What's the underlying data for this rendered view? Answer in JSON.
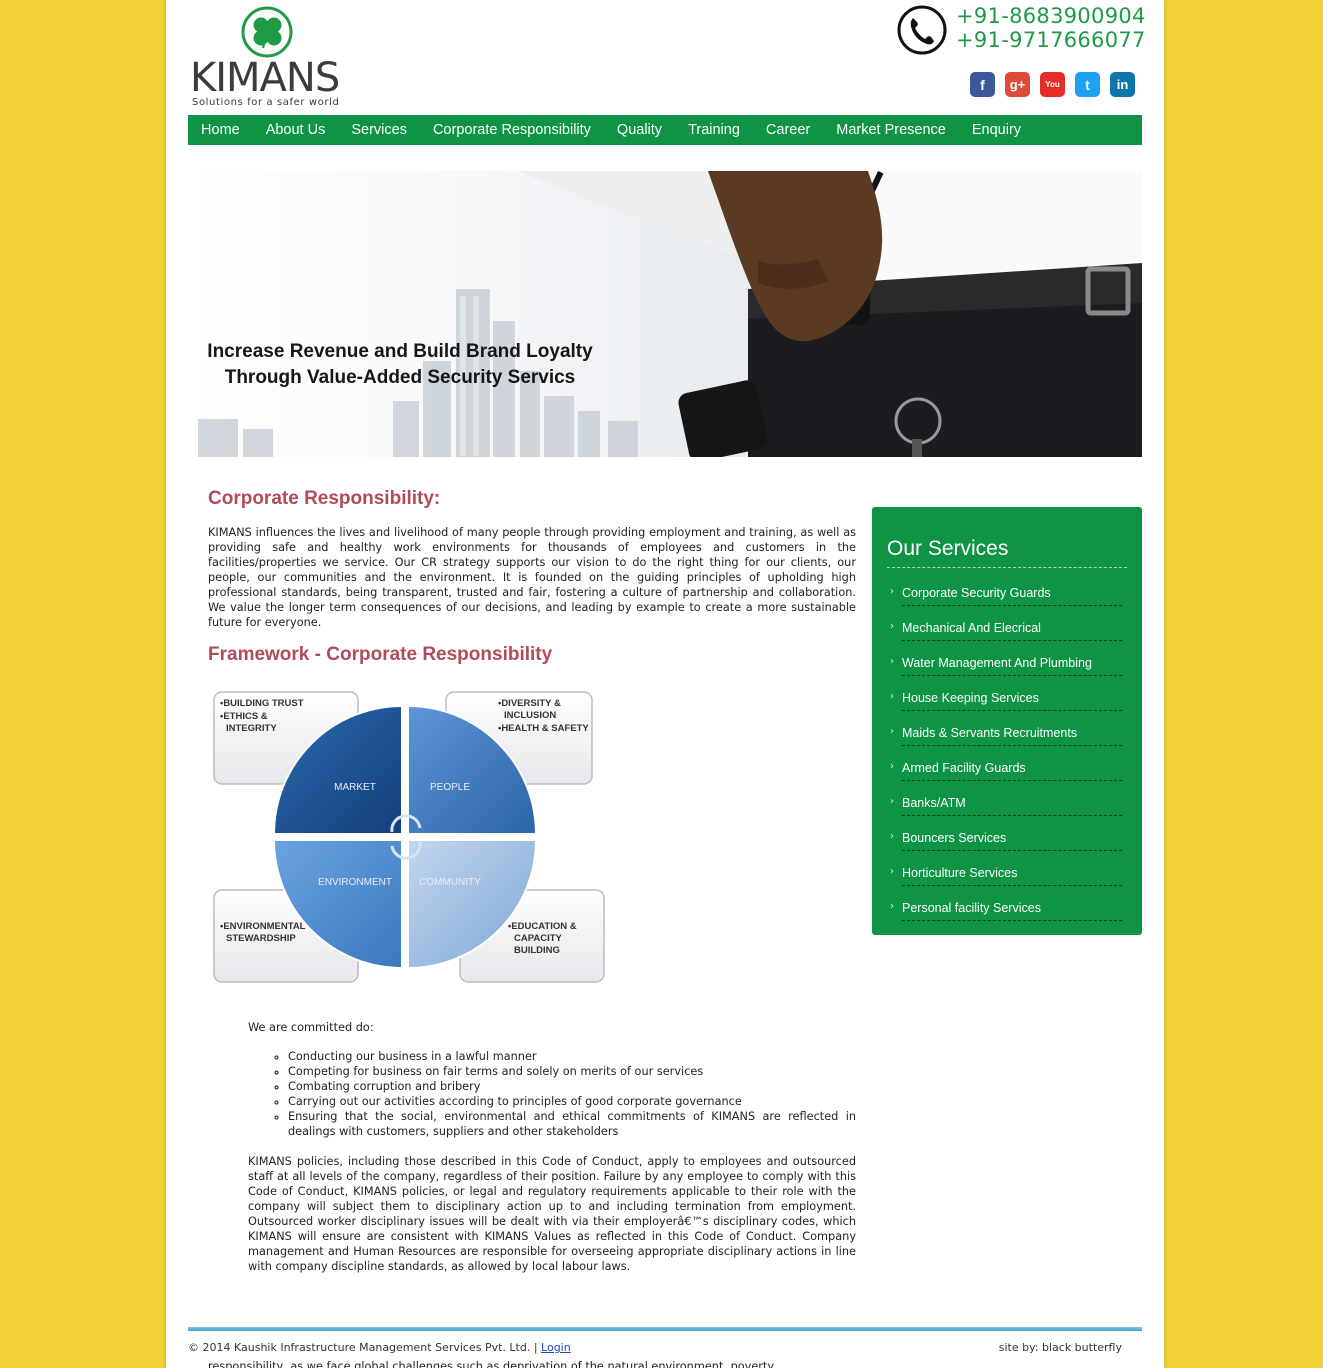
{
  "header": {
    "logo_text": "KIMANS",
    "tagline": "Solutions for a safer world",
    "phones": [
      "+91-8683900904",
      "+91-9717666077"
    ],
    "social": [
      {
        "name": "facebook",
        "glyph": "f",
        "color": "#3b5998"
      },
      {
        "name": "google-plus",
        "glyph": "g+",
        "color": "#dd4b39"
      },
      {
        "name": "youtube",
        "glyph": "You",
        "color": "#e52d27"
      },
      {
        "name": "twitter",
        "glyph": "t",
        "color": "#1da1f2"
      },
      {
        "name": "linkedin",
        "glyph": "in",
        "color": "#0e76a8"
      }
    ]
  },
  "nav": {
    "items": [
      "Home",
      "About Us",
      "Services",
      "Corporate Responsibility",
      "Quality",
      "Training",
      "Career",
      "Market Presence",
      "Enquiry"
    ]
  },
  "banner": {
    "line1": "Increase Revenue and Build Brand Loyalty",
    "line2": "Through Value-Added Security Servics"
  },
  "main": {
    "title": "Corporate Responsibility:",
    "intro": "KIMANS influences the lives and livelihood of many people through providing employment and training, as well as providing safe and healthy work environments for thousands of employees and customers in the facilities/properties we service. Our CR strategy supports our vision to do the right thing for our clients, our people, our communities and the environment. It is founded on the guiding principles of upholding high professional standards, being transparent, trusted and fair, fostering a culture of partnership and collaboration. We value the longer term consequences of our decisions, and leading by example to create a more sustainable future for everyone.",
    "framework_title": "Framework - Corporate Responsibility",
    "framework": {
      "quadrants": [
        "MARKET",
        "PEOPLE",
        "ENVIRONMENT",
        "COMMUNITY"
      ],
      "box_tl": [
        "•BUILDING TRUST",
        "•ETHICS &",
        "INTEGRITY"
      ],
      "box_tr": [
        "•DIVERSITY &",
        "INCLUSION",
        "•HEALTH & SAFETY"
      ],
      "box_bl": [
        "•ENVIRONMENTAL",
        "STEWARDSHIP"
      ],
      "box_br": [
        "•EDUCATION &",
        "CAPACITY",
        "BUILDING"
      ]
    },
    "committed_intro": "We are committed do:",
    "commitments": [
      "Conducting our business in a lawful manner",
      "Competing for business on fair terms and solely on merits of our services",
      "Combating corruption and bribery",
      "Carrying out our activities according to principles of good corporate governance",
      "Ensuring that the social, environmental and ethical commitments of KIMANS are reflected in dealings with customers, suppliers and other stakeholders"
    ],
    "policy": "KIMANS policies, including those described in this Code of Conduct, apply to employees and outsourced staff at all levels of the company, regardless of their position. Failure by any employee to comply with this Code of Conduct, KIMANS policies, or legal and regulatory requirements applicable to their role with the company will subject them to disciplinary action up to and including termination from employment. Outsourced worker disciplinary issues will be dealt with via their employerâ€™s disciplinary codes, which KIMANS will ensure are consistent with KIMANS Values as reflected in this Code of Conduct. Company management and Human Resources are responsible for overseeing appropriate disciplinary actions in line with company discipline standards, as allowed by local labour laws.",
    "clipped_text": "responsibility, as we face global challenges such as deprivation of the natural environment, poverty"
  },
  "sidebar": {
    "title": "Our Services",
    "items": [
      "Corporate Security Guards",
      "Mechanical And Elecrical",
      "Water Management And Plumbing",
      "House Keeping Services",
      "Maids & Servants Recruitments",
      "Armed Facility Guards",
      "Banks/ATM",
      "Bouncers Services",
      "Horticulture Services",
      "Personal facility Services"
    ]
  },
  "footer": {
    "copyright": "© 2014 Kaushik Infrastructure Management Services Pvt. Ltd. | ",
    "login": "Login",
    "credit": "site by: black butterfly"
  },
  "colors": {
    "page_bg": "#f2d335",
    "brand_green": "#0f9445",
    "heading": "#b04b5a",
    "phone_green": "#1f9a45"
  }
}
